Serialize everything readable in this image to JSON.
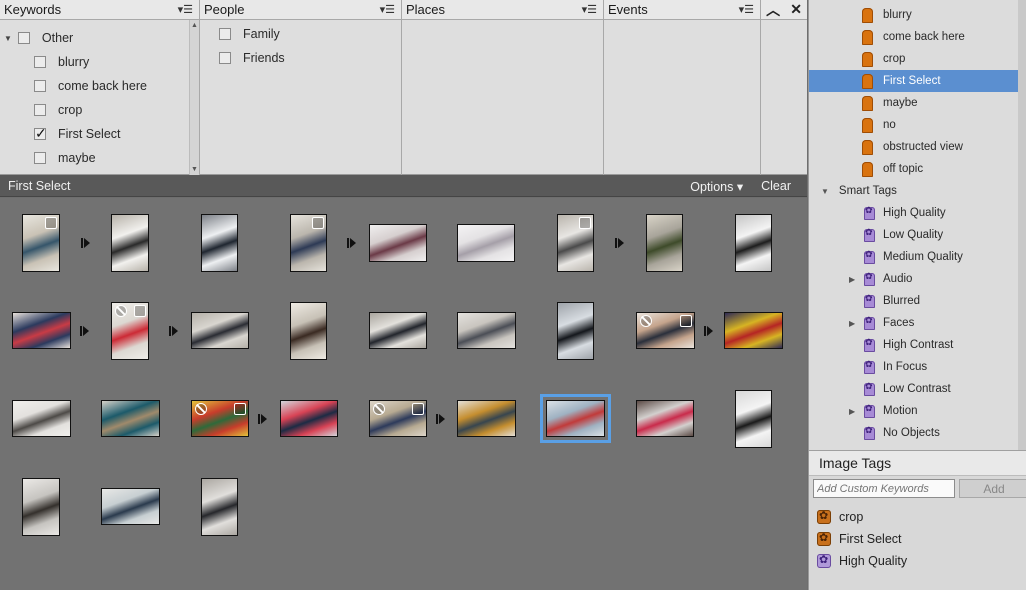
{
  "filter_bar": {
    "columns": [
      {
        "title": "Keywords",
        "parent": "Other",
        "items": [
          {
            "label": "blurry",
            "checked": false
          },
          {
            "label": "come back here",
            "checked": false
          },
          {
            "label": "crop",
            "checked": false
          },
          {
            "label": "First Select",
            "checked": true
          },
          {
            "label": "maybe",
            "checked": false
          }
        ]
      },
      {
        "title": "People",
        "items": [
          {
            "label": "Family",
            "checked": false
          },
          {
            "label": "Friends",
            "checked": false
          }
        ]
      },
      {
        "title": "Places",
        "items": []
      },
      {
        "title": "Events",
        "items": []
      }
    ],
    "collapse_icon": "chevron-up-icon",
    "close_icon": "close-icon"
  },
  "media_header": {
    "title": "First Select",
    "options_label": "Options",
    "clear_label": "Clear"
  },
  "thumbnails": [
    {
      "stacked": true,
      "stack_expand": true,
      "colors": [
        "#c9c2b5",
        "#35556a",
        "#e8e6df"
      ]
    },
    {
      "colors": [
        "#f2f1ee",
        "#2a2a2a",
        "#b7b2a9"
      ]
    },
    {
      "colors": [
        "#eef0f2",
        "#1f2630",
        "#7c8087"
      ]
    },
    {
      "stacked": true,
      "stack_expand": true,
      "colors": [
        "#bbb6ad",
        "#2d3a55",
        "#e6e3dc"
      ]
    },
    {
      "colors": [
        "#d6cfcf",
        "#6b3a47",
        "#f0efef"
      ]
    },
    {
      "colors": [
        "#e4e2e4",
        "#a59fa8",
        "#f4f3f4"
      ]
    },
    {
      "stacked": true,
      "stack_expand": true,
      "colors": [
        "#e8e6e3",
        "#4a4a4a",
        "#b9b4ac"
      ]
    },
    {
      "colors": [
        "#a8a49a",
        "#3e4b2a",
        "#d9d4c8"
      ]
    },
    {
      "colors": [
        "#f4f4f4",
        "#1d1d1d",
        "#c5c5c5"
      ]
    },
    {
      "colors": [
        "#2b3a5e",
        "#c93b45",
        "#e9e2dc"
      ]
    },
    {
      "stacked": true,
      "rejected": true,
      "stack_expand": true,
      "colors": [
        "#dcd8d2",
        "#cc2a35",
        "#efede9"
      ]
    },
    {
      "colors": [
        "#d9d6d0",
        "#2a2c33",
        "#b4b0a8"
      ]
    },
    {
      "colors": [
        "#c7c1b6",
        "#3a2a22",
        "#efebe4"
      ]
    },
    {
      "colors": [
        "#e3e1dc",
        "#22252c",
        "#a9a59e"
      ]
    },
    {
      "colors": [
        "#c9c5bf",
        "#4b4e56",
        "#e4e2de"
      ]
    },
    {
      "colors": [
        "#d8dde2",
        "#14171c",
        "#9ea3a9"
      ]
    },
    {
      "stacked": true,
      "rejected": true,
      "stack_expand": true,
      "colors": [
        "#c5a48c",
        "#2a2f3b",
        "#eae4dd"
      ]
    },
    {
      "colors": [
        "#d7b423",
        "#b52524",
        "#2f2b56"
      ]
    },
    {
      "colors": [
        "#e3e1de",
        "#4d4a47",
        "#f0efec"
      ]
    },
    {
      "colors": [
        "#1c5a6a",
        "#a08a6b",
        "#d7d2c9"
      ]
    },
    {
      "stacked": true,
      "rejected": true,
      "stack_expand": true,
      "colors": [
        "#c83d2b",
        "#2e6a3a",
        "#e2c33b"
      ]
    },
    {
      "colors": [
        "#d84355",
        "#1c2b44",
        "#d3d6dc"
      ]
    },
    {
      "stacked": true,
      "rejected": true,
      "stack_expand": true,
      "colors": [
        "#b7aa92",
        "#2d3a5b",
        "#dcd5c9"
      ]
    },
    {
      "colors": [
        "#c58e2f",
        "#37454f",
        "#e3dfd7"
      ]
    },
    {
      "selected": true,
      "colors": [
        "#9fb2c2",
        "#c13a3a",
        "#dbe1e6"
      ]
    },
    {
      "colors": [
        "#d3d0ce",
        "#c92b4b",
        "#5c4b46"
      ]
    },
    {
      "colors": [
        "#f4f4f4",
        "#1a1a1a",
        "#d8d8d8"
      ]
    },
    {
      "colors": [
        "#c6c4c0",
        "#34302c",
        "#ebe9e6"
      ]
    },
    {
      "colors": [
        "#c7cfd2",
        "#2a3a4d",
        "#e8e8e6"
      ]
    },
    {
      "colors": [
        "#e1dfdc",
        "#26272b",
        "#aba7a1"
      ]
    }
  ],
  "tag_tree": {
    "keyword_items": [
      "blurry",
      "come back here",
      "crop",
      "First Select",
      "maybe",
      "no",
      "obstructed view",
      "off topic"
    ],
    "selected_keyword": "First Select",
    "smart_tags_label": "Smart Tags",
    "smart_items": [
      {
        "label": "High Quality",
        "expandable": false
      },
      {
        "label": "Low Quality",
        "expandable": false
      },
      {
        "label": "Medium Quality",
        "expandable": false
      },
      {
        "label": "Audio",
        "expandable": true
      },
      {
        "label": "Blurred",
        "expandable": false
      },
      {
        "label": "Faces",
        "expandable": true
      },
      {
        "label": "High Contrast",
        "expandable": false
      },
      {
        "label": "In Focus",
        "expandable": false
      },
      {
        "label": "Low Contrast",
        "expandable": false
      },
      {
        "label": "Motion",
        "expandable": true
      },
      {
        "label": "No Objects",
        "expandable": false
      }
    ]
  },
  "image_tags": {
    "title": "Image Tags",
    "input_placeholder": "Add Custom Keywords",
    "add_label": "Add",
    "tags": [
      {
        "label": "crop",
        "kind": "keyword"
      },
      {
        "label": "First Select",
        "kind": "keyword"
      },
      {
        "label": "High Quality",
        "kind": "smart"
      }
    ]
  },
  "colors": {
    "accent_selected": "#5b8fd0",
    "keyword_tag": "#d9730f",
    "smart_tag": "#a78bd6"
  }
}
